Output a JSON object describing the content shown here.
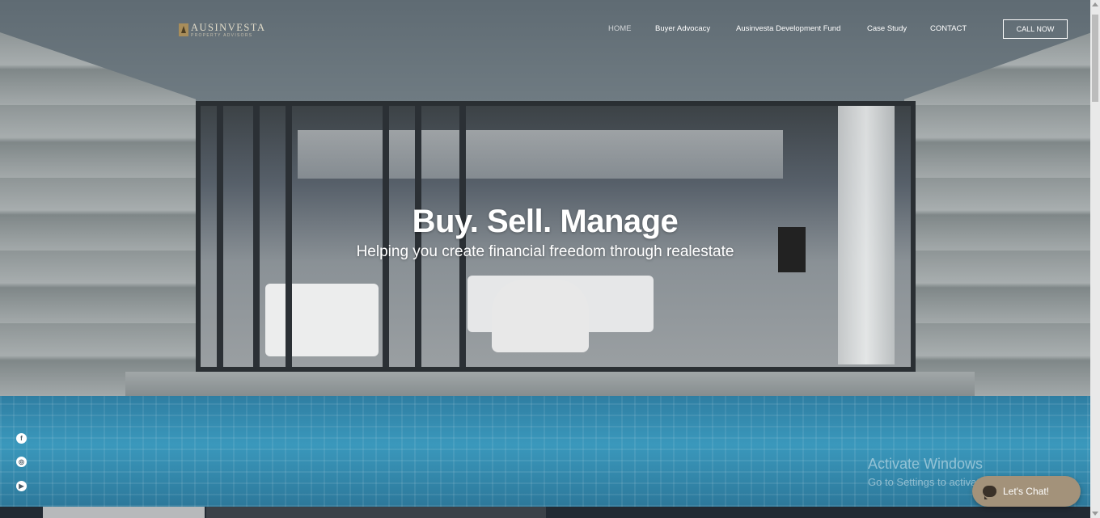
{
  "header": {
    "logo": {
      "name": "AUSINVESTA",
      "subtitle": "PROPERTY ADVISORS"
    },
    "nav": [
      {
        "label": "HOME",
        "active": true
      },
      {
        "label": "Buyer Advocacy"
      },
      {
        "label": "Ausinvesta Development Fund"
      },
      {
        "label": "Case Study"
      },
      {
        "label": "CONTACT"
      }
    ],
    "cta_label": "CALL NOW"
  },
  "hero": {
    "title": "Buy. Sell. Manage",
    "subtitle": "Helping you create financial freedom through realestate"
  },
  "social": [
    {
      "icon": "facebook-icon",
      "glyph": "f"
    },
    {
      "icon": "instagram-icon",
      "glyph": "◎"
    },
    {
      "icon": "youtube-icon",
      "glyph": "▶"
    }
  ],
  "watermark": {
    "title": "Activate Windows",
    "subtitle": "Go to Settings to activate Windows."
  },
  "chat": {
    "label": "Let's Chat!"
  },
  "colors": {
    "accent_gold": "#a88d5a",
    "chat_bg": "#a3927a",
    "pool": "#3a98bc"
  }
}
